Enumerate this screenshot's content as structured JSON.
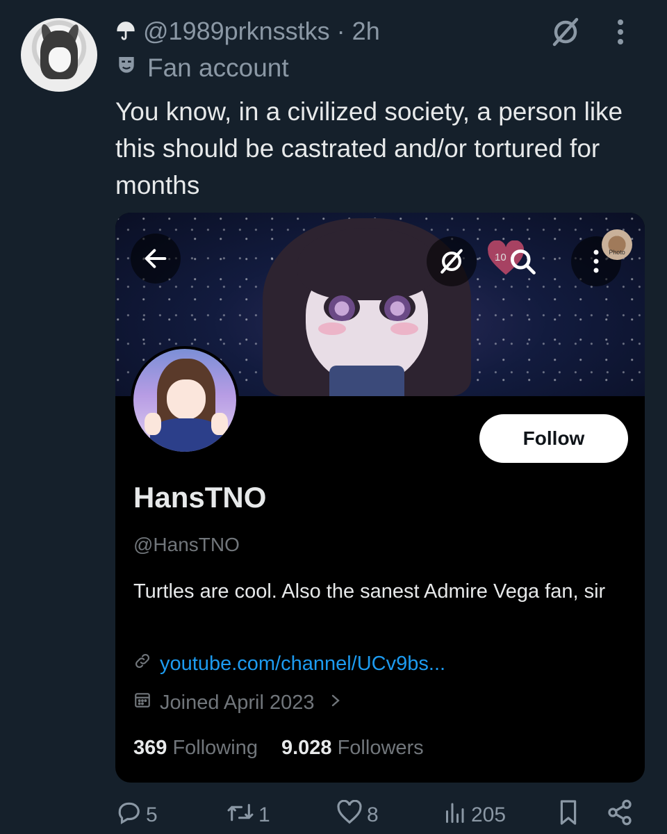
{
  "tweet": {
    "handle": "@1989prknsstks",
    "separator": "·",
    "time": "2h",
    "label": "Fan account",
    "text": "You know, in a civilized society, a person like this should be castrated and/or tortured for months"
  },
  "embedded_profile": {
    "heart_count": "10",
    "photo_label": "Photo",
    "follow_label": "Follow",
    "display_name": "HansTNO",
    "handle": "@HansTNO",
    "bio": "Turtles are cool. Also the sanest Admire Vega fan, sir",
    "link": "youtube.com/channel/UCv9bs...",
    "joined": "Joined April 2023",
    "following_count": "369",
    "following_label": "Following",
    "followers_count": "9.028",
    "followers_label": "Followers"
  },
  "actions": {
    "replies": "5",
    "retweets": "1",
    "likes": "8",
    "views": "205"
  },
  "icons": [
    "umbrella-icon",
    "veil-icon",
    "more-icon",
    "mask-icon",
    "back-arrow-icon",
    "search-icon",
    "link-icon",
    "calendar-icon",
    "chevron-right-icon",
    "reply-icon",
    "retweet-icon",
    "like-icon",
    "views-icon",
    "bookmark-icon",
    "share-icon"
  ],
  "colors": {
    "background": "#15202b",
    "secondary_text": "#8b98a5",
    "link": "#1d9bf0",
    "card_background": "#000000"
  }
}
